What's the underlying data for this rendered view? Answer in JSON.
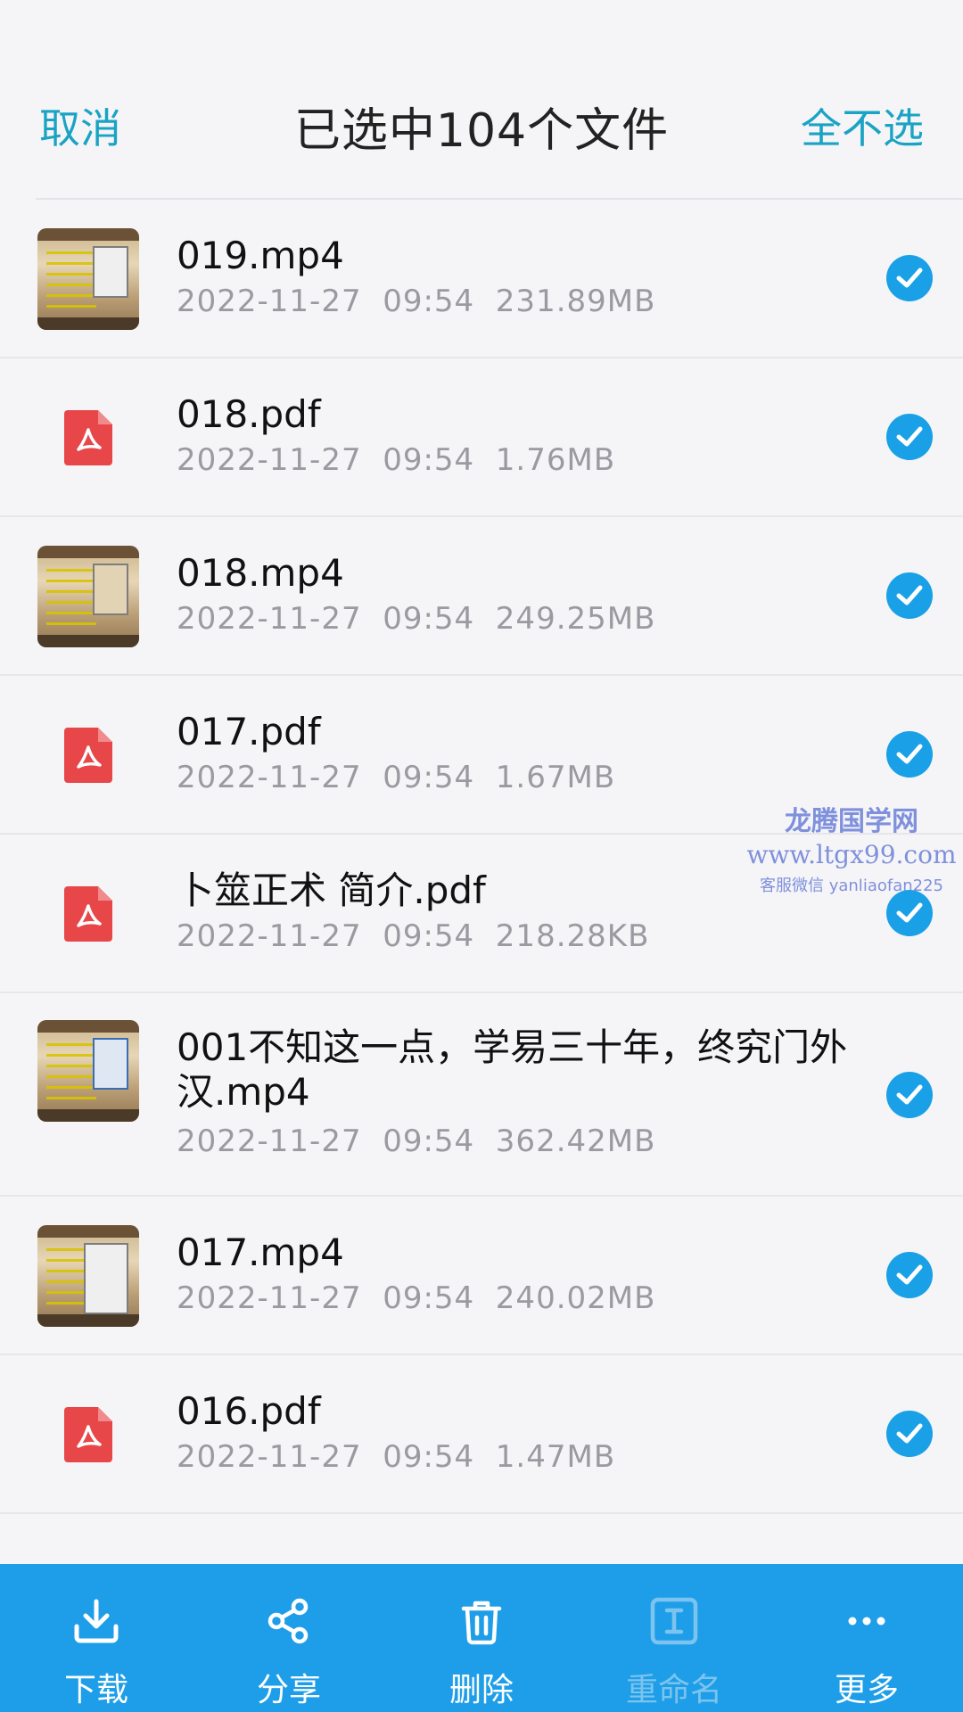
{
  "header": {
    "cancel_label": "取消",
    "title": "已选中104个文件",
    "deselect_all_label": "全不选"
  },
  "files": [
    {
      "name": "019.mp4",
      "meta": "2022-11-27  09:54  231.89MB",
      "type": "video",
      "selected": true
    },
    {
      "name": "018.pdf",
      "meta": "2022-11-27  09:54  1.76MB",
      "type": "pdf",
      "selected": true
    },
    {
      "name": "018.mp4",
      "meta": "2022-11-27  09:54  249.25MB",
      "type": "video",
      "selected": true
    },
    {
      "name": "017.pdf",
      "meta": "2022-11-27  09:54  1.67MB",
      "type": "pdf",
      "selected": true
    },
    {
      "name": "卜筮正术 简介.pdf",
      "meta": "2022-11-27  09:54  218.28KB",
      "type": "pdf",
      "selected": true
    },
    {
      "name": "001不知这一点，学易三十年，终究门外汉.mp4",
      "meta": "2022-11-27  09:54  362.42MB",
      "type": "video",
      "selected": true
    },
    {
      "name": "017.mp4",
      "meta": "2022-11-27  09:54  240.02MB",
      "type": "video",
      "selected": true
    },
    {
      "name": "016.pdf",
      "meta": "2022-11-27  09:54  1.47MB",
      "type": "pdf",
      "selected": true
    }
  ],
  "watermark": {
    "line1": "龙腾国学网",
    "line2": "www.ltgx99.com",
    "line3": "客服微信 yanliaofan225"
  },
  "toolbar": {
    "download_label": "下载",
    "share_label": "分享",
    "delete_label": "删除",
    "rename_label": "重命名",
    "more_label": "更多"
  },
  "colors": {
    "accent": "#1aa3c4",
    "toolbar_bg": "#1e9ee8",
    "check_bg": "#19a0e6",
    "pdf_red": "#e8474a"
  }
}
